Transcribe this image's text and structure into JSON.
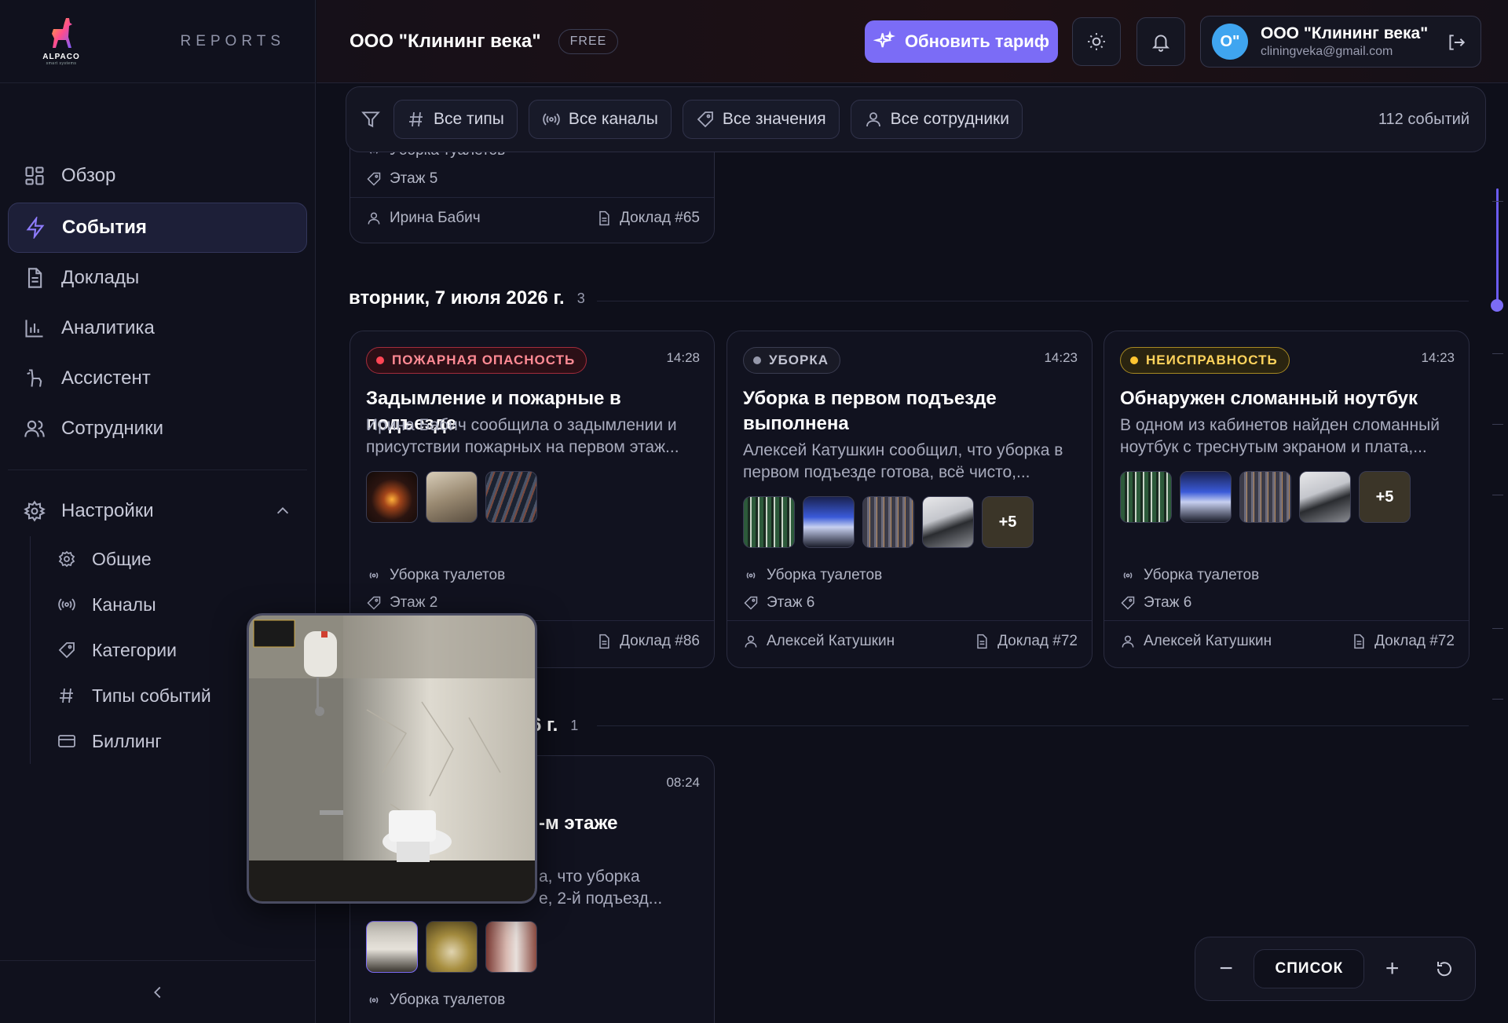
{
  "brand": {
    "logo_name": "ALPACO",
    "logo_sub": "smart systems",
    "section": "REPORTS"
  },
  "sidebar": {
    "items": [
      {
        "label": "Обзор",
        "icon": "grid-icon"
      },
      {
        "label": "События",
        "icon": "bolt-icon",
        "active": true
      },
      {
        "label": "Доклады",
        "icon": "document-icon"
      },
      {
        "label": "Аналитика",
        "icon": "bar-chart-icon"
      },
      {
        "label": "Ассистент",
        "icon": "alpaca-icon"
      },
      {
        "label": "Сотрудники",
        "icon": "users-icon"
      }
    ],
    "settings": {
      "label": "Настройки",
      "children": [
        {
          "label": "Общие",
          "icon": "gear-icon"
        },
        {
          "label": "Каналы",
          "icon": "broadcast-icon"
        },
        {
          "label": "Категории",
          "icon": "tag-icon"
        },
        {
          "label": "Типы событий",
          "icon": "hash-icon"
        },
        {
          "label": "Биллинг",
          "icon": "card-icon"
        }
      ]
    }
  },
  "header": {
    "org": "ООО \"Клининг века\"",
    "plan": "FREE",
    "upgrade": "Обновить тариф",
    "user_initials": "О\"",
    "user_name": "ООО \"Клининг века\"",
    "user_email": "cliningveka@gmail.com"
  },
  "filters": {
    "types": "Все типы",
    "channels": "Все каналы",
    "values": "Все значения",
    "employees": "Все сотрудники",
    "count": "112 событий"
  },
  "top_card": {
    "channel": "Уборка туалетов",
    "floor": "Этаж 5",
    "author": "Ирина Бабич",
    "report": "Доклад #65"
  },
  "day1": {
    "title": "вторник, 7 июля 2026 г.",
    "count": "3",
    "cards": [
      {
        "badge": "ПОЖАРНАЯ ОПАСНОСТЬ",
        "time": "14:28",
        "title": "Задымление и пожарные в подъезде",
        "desc": "Ирина Бабич сообщила о задымлении и присутствии пожарных на первом этаж...",
        "channel": "Уборка туалетов",
        "floor": "Этаж 2",
        "report": "Доклад #86"
      },
      {
        "badge": "УБОРКА",
        "time": "14:23",
        "title": "Уборка в первом подъезде выполнена",
        "desc": "Алексей Катушкин сообщил, что уборка в первом подъезде готова, всё чисто,...",
        "more": "+5",
        "channel": "Уборка туалетов",
        "floor": "Этаж 6",
        "author": "Алексей Катушкин",
        "report": "Доклад #72"
      },
      {
        "badge": "НЕИСПРАВНОСТЬ",
        "time": "14:23",
        "title": "Обнаружен сломанный ноутбук",
        "desc": "В одном из кабинетов найден сломанный ноутбук с треснутым экраном и плата,...",
        "more": "+5",
        "channel": "Уборка туалетов",
        "floor": "Этаж 6",
        "author": "Алексей Катушкин",
        "report": "Доклад #72"
      }
    ]
  },
  "day2": {
    "title_fragment": "6 г.",
    "count": "1",
    "card": {
      "time": "08:24",
      "title_fragment": "-м этаже",
      "desc_line1": "а, что уборка",
      "desc_line2": "е, 2-й подъезд...",
      "channel": "Уборка туалетов"
    }
  },
  "zoom": {
    "label": "СПИСОК",
    "minus": "−",
    "plus": "+"
  },
  "colors": {
    "accent": "#7b6cf6",
    "fire": "#ff4655",
    "fault": "#ffc531"
  }
}
